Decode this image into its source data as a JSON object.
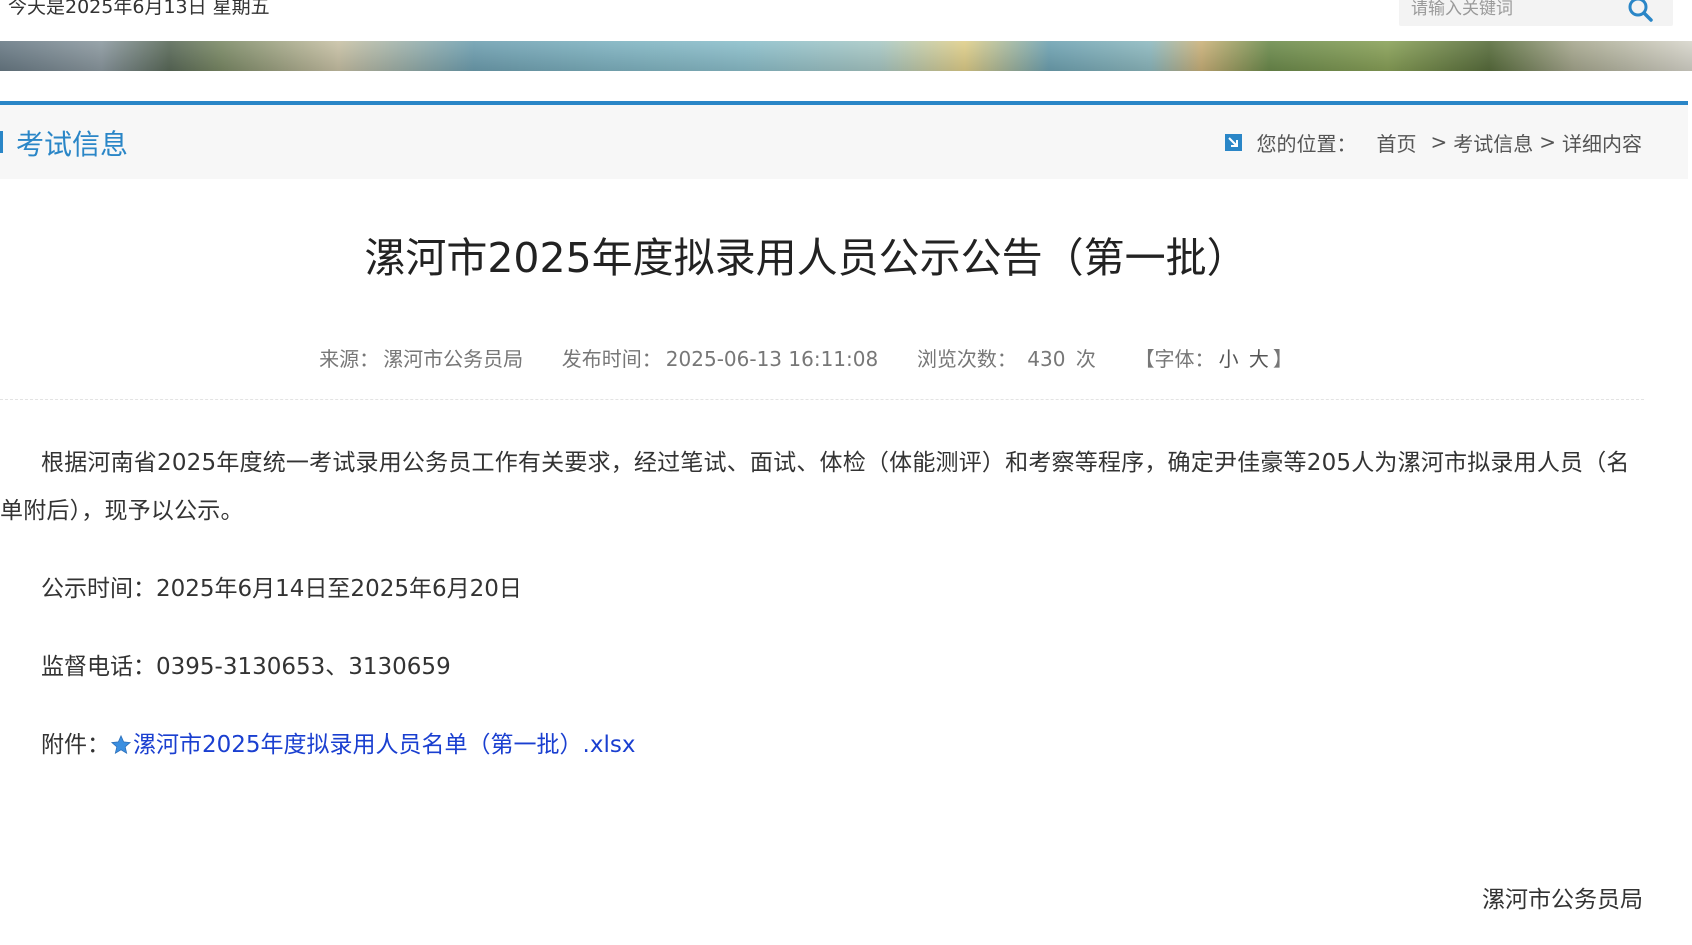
{
  "topbar": {
    "date_text": "今天是2025年6月13日 星期五",
    "search_placeholder": "请输入关键词",
    "search_icon": "search-icon"
  },
  "section": {
    "title": "考试信息"
  },
  "breadcrumb": {
    "prefix": "您的位置：",
    "items": [
      "首页",
      "考试信息",
      "详细内容"
    ],
    "separator": ">",
    "icon": "location-arrow-icon"
  },
  "article": {
    "title": "漯河市2025年度拟录用人员公示公告（第一批）",
    "meta": {
      "source_label": "来源：",
      "source": "漯河市公务员局",
      "time_label": "发布时间：",
      "time": "2025-06-13 16:11:08",
      "views_label": "浏览次数：",
      "views": "430",
      "views_unit": "次",
      "font_label": "【字体：",
      "font_small": "小",
      "font_large": "大",
      "font_close": "】"
    },
    "body": "根据河南省2025年度统一考试录用公务员工作有关要求，经过笔试、面试、体检（体能测评）和考察等程序，确定尹佳豪等205人为漯河市拟录用人员（名单附后），现予以公示。",
    "notice_period_label": "公示时间：",
    "notice_period": "2025年6月14日至2025年6月20日",
    "phone_label": "监督电话：",
    "phone": "0395-3130653、3130659",
    "attachment_label": "附件：",
    "attachment_name": "漯河市2025年度拟录用人员名单（第一批）.xlsx",
    "attachment_icon": "star-icon",
    "signature": "漯河市公务员局"
  },
  "colors": {
    "accent": "#2a86c7",
    "link": "#1a3fd0",
    "text": "#333333",
    "meta": "#777777"
  }
}
